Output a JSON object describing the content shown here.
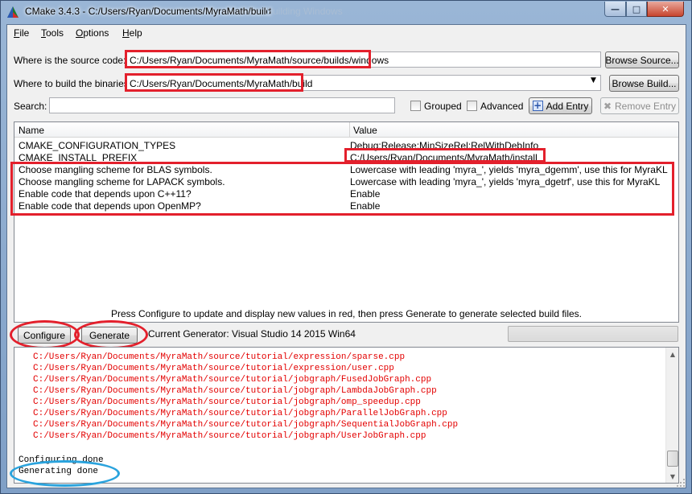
{
  "window": {
    "title": "CMake 3.4.3 - C:/Users/Ryan/Documents/MyraMath/build",
    "title_ghost": "Building Windows",
    "min_glyph": "—",
    "max_glyph": "□",
    "close_glyph": "✕"
  },
  "menu": [
    "File",
    "Tools",
    "Options",
    "Help"
  ],
  "source": {
    "label": "Where is the source code:",
    "value": "C:/Users/Ryan/Documents/MyraMath/source/builds/windows",
    "button": "Browse Source..."
  },
  "build": {
    "label": "Where to build the binaries:",
    "value": "C:/Users/Ryan/Documents/MyraMath/build",
    "button": "Browse Build..."
  },
  "search": {
    "label": "Search:",
    "value": "",
    "grouped": "Grouped",
    "advanced": "Advanced",
    "add_entry": "Add Entry",
    "remove_entry": "Remove Entry"
  },
  "table": {
    "headers": [
      "Name",
      "Value"
    ],
    "rows": [
      {
        "name": "CMAKE_CONFIGURATION_TYPES",
        "value": "Debug;Release;MinSizeRel;RelWithDebInfo"
      },
      {
        "name": "CMAKE_INSTALL_PREFIX",
        "value": "C:/Users/Ryan/Documents/MyraMath/install"
      },
      {
        "name": "Choose mangling scheme for BLAS symbols.",
        "value": "Lowercase with leading 'myra_', yields 'myra_dgemm', use this for MyraKL"
      },
      {
        "name": "Choose mangling scheme for LAPACK symbols.",
        "value": "Lowercase with leading 'myra_', yields 'myra_dgetrf', use this for MyraKL"
      },
      {
        "name": "Enable code that depends upon C++11?",
        "value": "Enable"
      },
      {
        "name": "Enable code that depends upon OpenMP?",
        "value": "Enable"
      }
    ]
  },
  "hint": "Press Configure to update and display new values in red, then press Generate to generate selected build files.",
  "actions": {
    "configure": "Configure",
    "generate": "Generate",
    "current_generator": "Current Generator: Visual Studio 14 2015 Win64"
  },
  "log": {
    "errors": [
      "C:/Users/Ryan/Documents/MyraMath/source/tutorial/expression/sparse.cpp",
      "C:/Users/Ryan/Documents/MyraMath/source/tutorial/expression/user.cpp",
      "C:/Users/Ryan/Documents/MyraMath/source/tutorial/jobgraph/FusedJobGraph.cpp",
      "C:/Users/Ryan/Documents/MyraMath/source/tutorial/jobgraph/LambdaJobGraph.cpp",
      "C:/Users/Ryan/Documents/MyraMath/source/tutorial/jobgraph/omp_speedup.cpp",
      "C:/Users/Ryan/Documents/MyraMath/source/tutorial/jobgraph/ParallelJobGraph.cpp",
      "C:/Users/Ryan/Documents/MyraMath/source/tutorial/jobgraph/SequentialJobGraph.cpp",
      "C:/Users/Ryan/Documents/MyraMath/source/tutorial/jobgraph/UserJobGraph.cpp"
    ],
    "status": [
      "Configuring done",
      "Generating done"
    ]
  },
  "colors": {
    "annotation_red": "#e3202c",
    "annotation_blue": "#2aa3dd",
    "log_error": "#e30000"
  }
}
